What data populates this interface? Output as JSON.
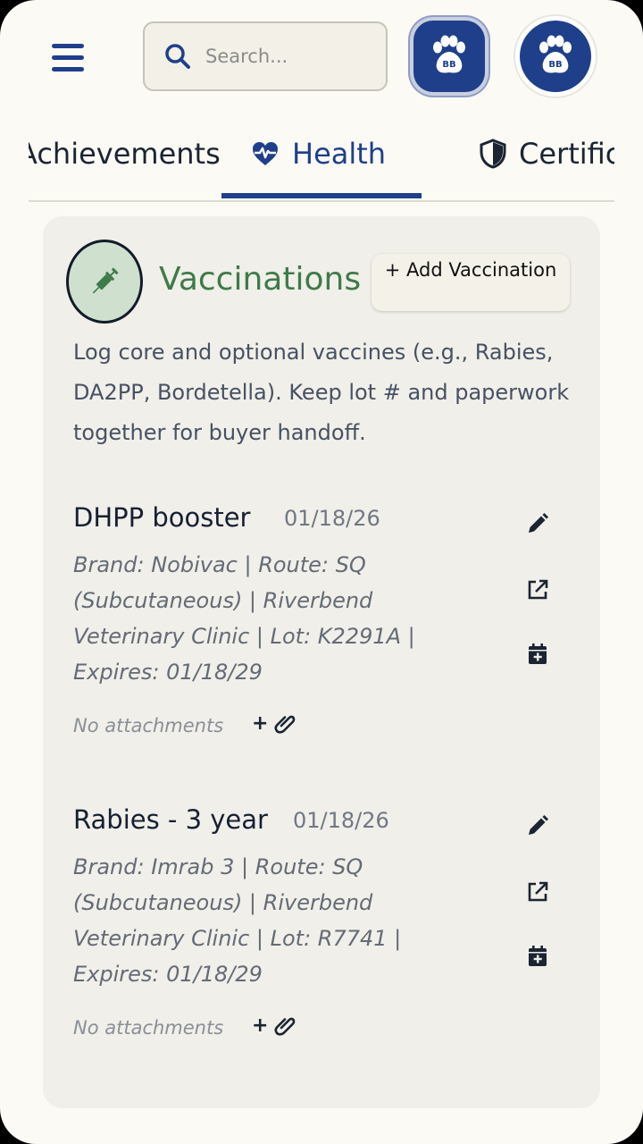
{
  "header": {
    "search_placeholder": "Search...",
    "avatar_initials": "BB"
  },
  "tabs": [
    {
      "label": "Achievements"
    },
    {
      "label": "Health",
      "active": true
    },
    {
      "label": "Certifications"
    }
  ],
  "vaccinations": {
    "title": "Vaccinations",
    "add_button": "+ Add Vaccination",
    "description": "Log core and optional vaccines (e.g., Rabies, DA2PP, Bordetella). Keep lot # and paperwork together for buyer handoff.",
    "entries": [
      {
        "name": "DHPP booster",
        "date": "01/18/26",
        "details": "Brand: Nobivac | Route: SQ (Subcutaneous) | Riverbend Veterinary Clinic | Lot: K2291A | Expires: 01/18/29",
        "attachments": "No attachments",
        "attach_add": "+"
      },
      {
        "name": "Rabies - 3 year",
        "date": "01/18/26",
        "details": "Brand: Imrab 3 | Route: SQ (Subcutaneous) | Riverbend Veterinary Clinic | Lot: R7741 | Expires: 01/18/29",
        "attachments": "No attachments",
        "attach_add": "+"
      }
    ]
  },
  "colors": {
    "primary": "#1f3f8a",
    "accent_green": "#3f7a49",
    "background": "#fbfaf4",
    "card": "#f0efe9"
  },
  "icons": [
    "menu-icon",
    "search-icon",
    "paw-icon",
    "heart-pulse-icon",
    "shield-icon",
    "syringe-icon",
    "pencil-icon",
    "external-link-icon",
    "calendar-add-icon",
    "paperclip-icon"
  ]
}
